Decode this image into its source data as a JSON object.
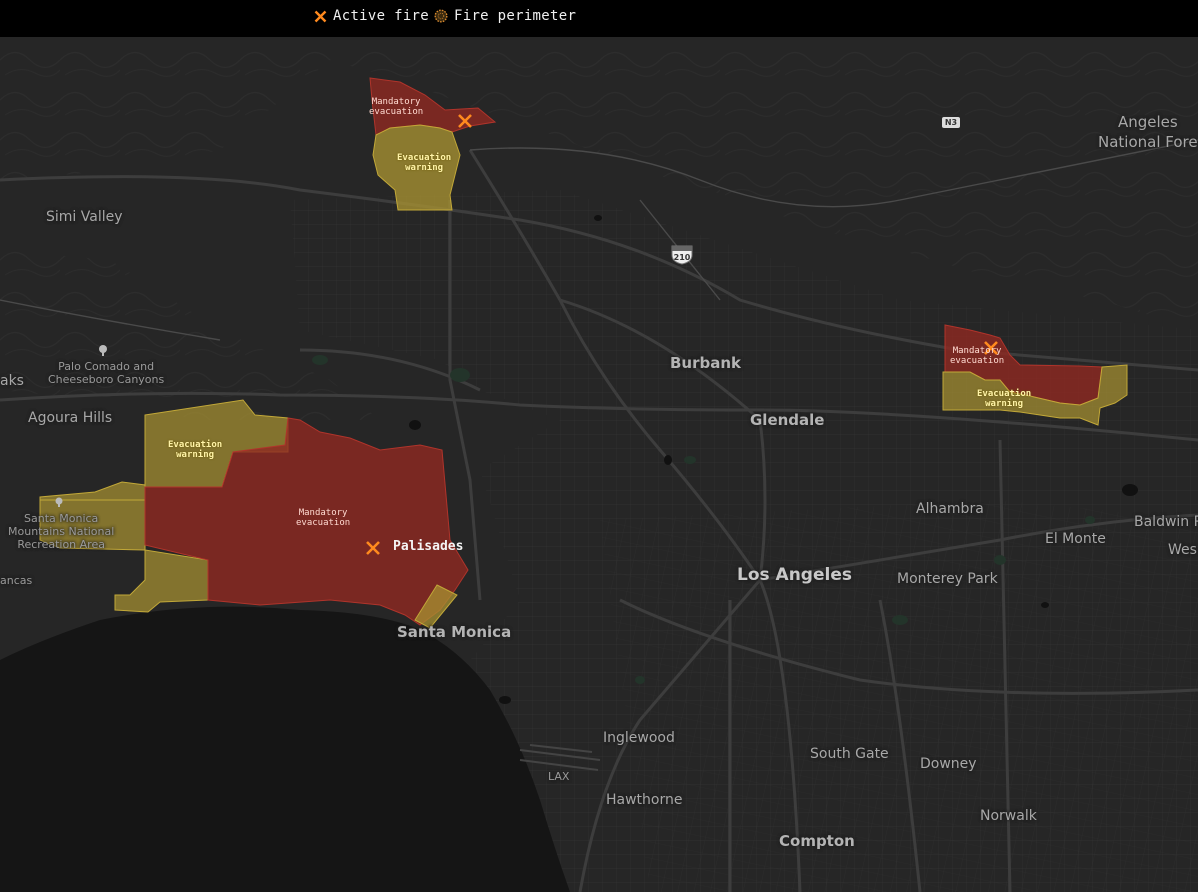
{
  "legend": {
    "active_fire": "Active fire",
    "fire_perimeter": "Fire perimeter"
  },
  "colors": {
    "fire_marker": "#ff8a1e",
    "mandatory_fill": "#8e2a22",
    "warning_fill": "#a89232",
    "water": "#151515",
    "land": "#262626"
  },
  "places": {
    "simi_valley": "Simi Valley",
    "palo_comado": "Palo Comado and\nCheeseboro Canyons",
    "oaks": "aks",
    "agoura_hills": "Agoura Hills",
    "santa_monica_mountains": "Santa Monica\nMountains National\nRecreation Area",
    "ancas": "ancas",
    "santa_monica": "Santa Monica",
    "burbank": "Burbank",
    "glendale": "Glendale",
    "alhambra": "Alhambra",
    "el_monte": "El Monte",
    "baldwin_park": "Baldwin Pa",
    "west": "Wes",
    "los_angeles": "Los Angeles",
    "monterey_park": "Monterey Park",
    "inglewood": "Inglewood",
    "south_gate": "South Gate",
    "downey": "Downey",
    "lax": "LAX",
    "hawthorne": "Hawthorne",
    "norwalk": "Norwalk",
    "compton": "Compton",
    "angeles_forest": "Angeles\nNational Fore"
  },
  "shields": {
    "i210": "210",
    "n3": "N3"
  },
  "fires": {
    "palisades": {
      "name": "Palisades",
      "mandatory_label": "Mandatory\nevacuation",
      "warning_label": "Evacuation\nwarning"
    },
    "north": {
      "mandatory_label": "Mandatory\nevacuation",
      "warning_label": "Evacuation\nwarning"
    },
    "east": {
      "mandatory_label": "Mandatory\nevacuation",
      "warning_label": "Evacuation\nwarning"
    }
  }
}
